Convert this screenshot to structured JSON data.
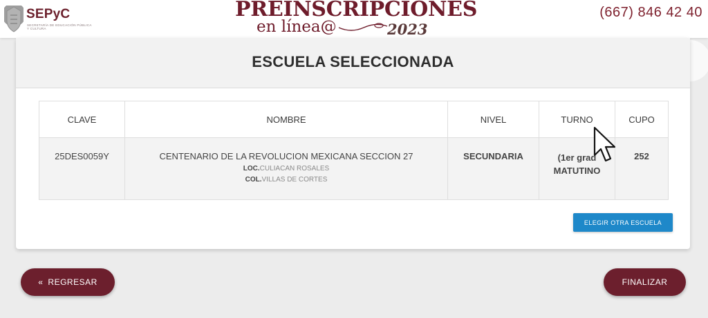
{
  "header": {
    "logo": {
      "name": "SEPyC",
      "subtitle": "Secretaría de Educación Pública y Cultura"
    },
    "brand": {
      "title": "PREINSCRIPCIONES",
      "subtitle": "en línea@",
      "year": "2023"
    },
    "phone": "(667) 846 42 40"
  },
  "card": {
    "title": "ESCUELA SELECCIONADA",
    "table": {
      "headers": {
        "clave": "CLAVE",
        "nombre": "NOMBRE",
        "nivel": "NIVEL",
        "turno": "TURNO",
        "cupo": "CUPO"
      },
      "row": {
        "clave": "25DES0059Y",
        "nombre": "CENTENARIO DE LA REVOLUCION MEXICANA SECCION 27",
        "loc_label": "LOC.",
        "loc_value": "CULIACAN ROSALES",
        "col_label": "COL.",
        "col_value": "VILLAS DE CORTES",
        "nivel": "SECUNDARIA",
        "turno_grado": "(1er grad",
        "turno": "MATUTINO",
        "cupo": "252"
      }
    },
    "choose_other_label": "ELEGIR OTRA ESCUELA"
  },
  "nav": {
    "back_label": "REGRESAR",
    "back_icon": "double-chevron-left-icon",
    "finish_label": "FINALIZAR"
  },
  "colors": {
    "brand": "#6c1f2d",
    "accent_blue": "#1e88c9",
    "nivel": "#f5b041",
    "success_green": "#27ae60"
  }
}
